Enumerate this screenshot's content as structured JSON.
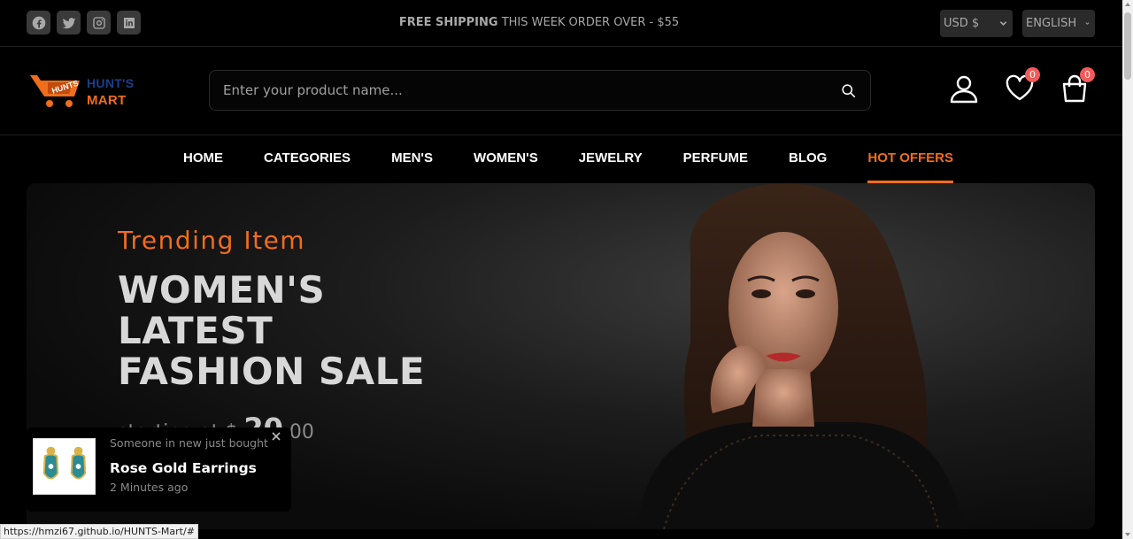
{
  "topbar": {
    "socials": [
      {
        "icon": "facebook-icon"
      },
      {
        "icon": "twitter-icon"
      },
      {
        "icon": "instagram-icon"
      },
      {
        "icon": "linkedin-icon"
      }
    ],
    "promo_bold": "FREE SHIPPING",
    "promo_rest": "THIS WEEK ORDER OVER - $55",
    "currency": "USD $",
    "language": "ENGLISH"
  },
  "header": {
    "logo_line1": "HUNT'S",
    "logo_line2": "MART",
    "search_placeholder": "Enter your product name...",
    "wishlist_count": "0",
    "cart_count": "0"
  },
  "nav": {
    "items": [
      {
        "label": "HOME"
      },
      {
        "label": "CATEGORIES"
      },
      {
        "label": "MEN'S"
      },
      {
        "label": "WOMEN'S"
      },
      {
        "label": "JEWELRY"
      },
      {
        "label": "PERFUME"
      },
      {
        "label": "BLOG"
      },
      {
        "label": "HOT OFFERS"
      }
    ]
  },
  "hero": {
    "subtitle": "Trending Item",
    "title": "WOMEN'S LATEST FASHION SALE",
    "price_prefix": "starting at $",
    "price_amount": "20",
    "price_suffix": ".00"
  },
  "toast": {
    "label": "Someone in new just bought",
    "product": "Rose Gold Earrings",
    "time": "2 Minutes ago"
  },
  "status": {
    "url": "https://hmzi67.github.io/HUNTS-Mart/#"
  },
  "colors": {
    "accent": "#f06d1b",
    "badge": "#f45a5a",
    "background": "#000000"
  }
}
